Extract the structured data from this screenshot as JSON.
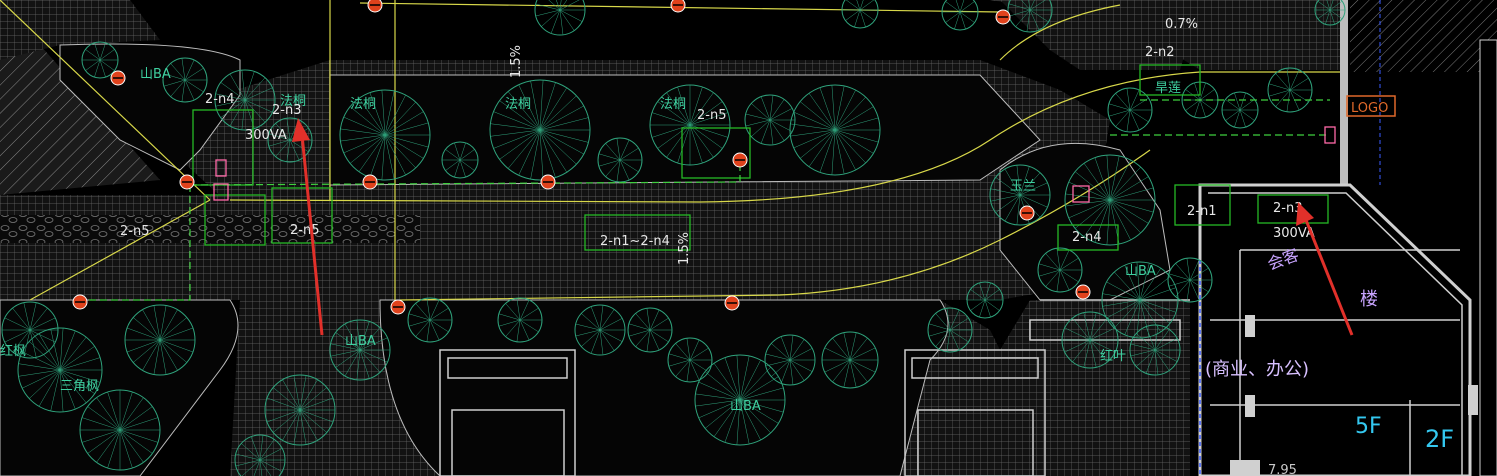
{
  "theme": {
    "background": "#000000",
    "paving_hatch": "#6e6e6e",
    "tree_outline": "#2fa37c",
    "tree_label": "#3fd0a0",
    "cable_route": "#25b925",
    "dashed_cable": "#3fcf3f",
    "road_edge": "#d8d84a",
    "lamp_fill": "#e0421c",
    "building_wall": "#cfcfcf",
    "arrow": "#e1302a",
    "floor_label": "#34c8f0",
    "logo_box": "#e0692a"
  },
  "labels": {
    "slope_07": "0.7%",
    "slope_15_top": "1.5%",
    "slope_15_mid": "1.5%",
    "n2": "2-n2",
    "n1": "2-n1",
    "n3_right": "2-n3",
    "va_right": "300VA",
    "n4_right": "2-n4",
    "n5_center": "2-n5",
    "n4_left": "2-n4",
    "n3_left": "2-n3",
    "va_left": "300VA",
    "n5_left": "2-n5",
    "n5_small": "2-n5",
    "range": "2-n1~2-n4",
    "logo": "LOGO",
    "floor_5f": "5F",
    "floor_2f": "2F",
    "building_use": "(商业、办公)",
    "room_stair": "楼",
    "room_reception": "会客",
    "room_office": "商",
    "tree_sanfeng": "三角枫",
    "tree_hongfeng": "红枫",
    "tree_fa": "法桐",
    "tree_ba": "山BA",
    "tree_hanlian": "旱莲",
    "tree_yulan": "玉兰",
    "tree_hongye": "红叶",
    "level": "7.95"
  },
  "icons": [
    "lamp-icon",
    "junction-box-icon",
    "arrow-icon"
  ]
}
